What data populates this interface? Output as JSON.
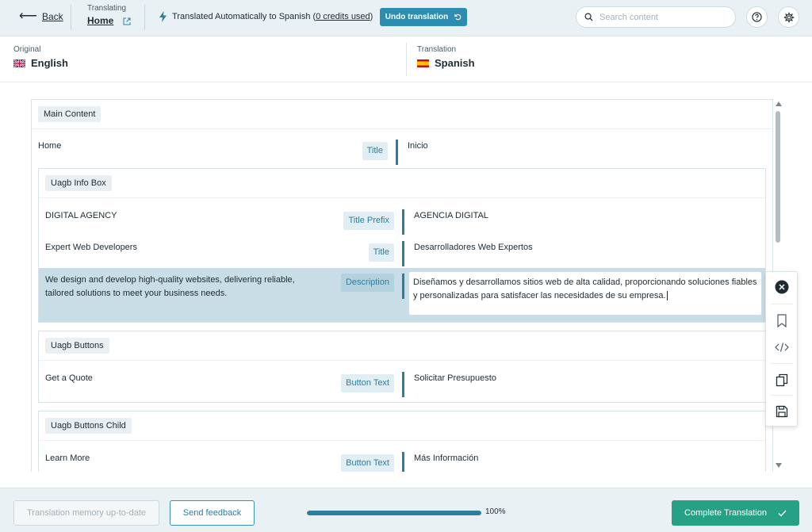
{
  "header": {
    "back_label": "Back",
    "translating_label": "Translating",
    "page_name": "Home",
    "auto_text_prefix": "Translated Automatically to Spanish (",
    "credits_text": "0 credits used",
    "auto_text_suffix": ")",
    "undo_label": "Undo translation",
    "search_placeholder": "Search content"
  },
  "languages": {
    "original_label": "Original",
    "original_name": "English",
    "translation_label": "Translation",
    "translation_name": "Spanish"
  },
  "content": {
    "main_section": "Main Content",
    "home_row": {
      "source": "Home",
      "field": "Title",
      "target": "Inicio"
    },
    "infobox": {
      "title": "Uagb Info Box",
      "rows": [
        {
          "source": "DIGITAL AGENCY",
          "field": "Title Prefix",
          "target": "AGENCIA DIGITAL"
        },
        {
          "source": "Expert Web Developers",
          "field": "Title",
          "target": "Desarrolladores Web Expertos"
        },
        {
          "source": "We design and develop high-quality websites, delivering reliable, tailored solutions to meet your business needs.",
          "field": "Description",
          "target": "Diseñamos y desarrollamos sitios web de alta calidad, proporcionando soluciones fiables y personalizadas para satisfacer las necesidades de su empresa."
        }
      ]
    },
    "buttons": {
      "title": "Uagb Buttons",
      "row": {
        "source": "Get a Quote",
        "field": "Button Text",
        "target": "Solicitar Presupuesto"
      }
    },
    "buttons_child": {
      "title": "Uagb Buttons Child",
      "row": {
        "source": "Learn More",
        "field": "Button Text",
        "target": "Más Información"
      }
    }
  },
  "tools": [
    "close-icon",
    "bookmark-icon",
    "code-icon",
    "copy-icon",
    "save-icon"
  ],
  "footer": {
    "memory_label": "Translation memory up-to-date",
    "feedback_label": "Send feedback",
    "progress_percent": 100,
    "progress_label": "100%",
    "complete_label": "Complete Translation"
  },
  "colors": {
    "accent": "#2d7e9e",
    "undo": "#2d8db1",
    "complete": "#27a185",
    "highlight": "#c8dde6"
  }
}
